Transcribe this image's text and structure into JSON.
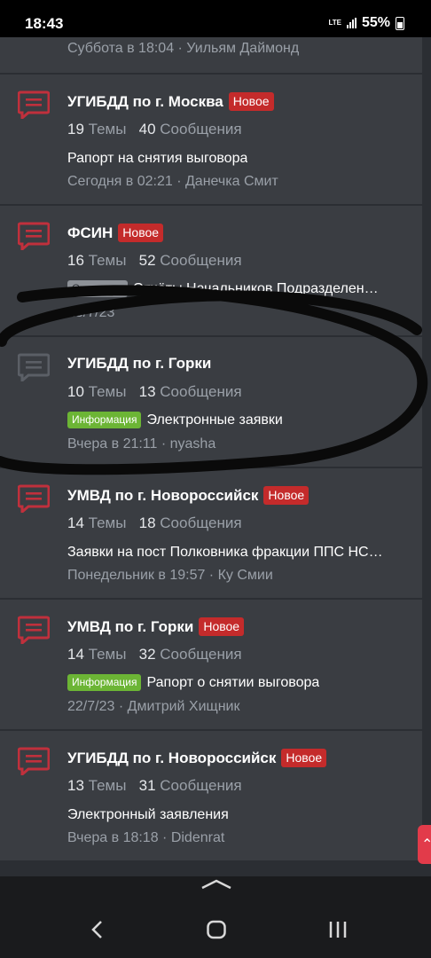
{
  "status": {
    "time": "18:43",
    "network": "LTE",
    "battery": "55%"
  },
  "partial": {
    "meta": "Суббота в 18:04 · Уильям Даймонд"
  },
  "forums": [
    {
      "title": "УГИБДД по г. Москва",
      "new": "Новое",
      "themes": "19",
      "themes_label": "Темы",
      "messages": "40",
      "messages_label": "Сообщения",
      "last_title": "Рапорт на снятия выговора",
      "meta": "Сегодня в 02:21 · Данечка Смит"
    },
    {
      "title": "ФСИН",
      "new": "Новое",
      "themes": "16",
      "themes_label": "Темы",
      "messages": "52",
      "messages_label": "Сообщения",
      "prefix": "Ожидание",
      "last_title": "Отчёты Начальников Подразделен…",
      "meta": "23/7/23"
    },
    {
      "title": "УГИБДД по г. Горки",
      "themes": "10",
      "themes_label": "Темы",
      "messages": "13",
      "messages_label": "Сообщения",
      "prefix": "Информация",
      "last_title": "Электронные заявки",
      "meta": "Вчера в 21:11 · nyasha"
    },
    {
      "title": "УМВД по г. Новороссийск",
      "new": "Новое",
      "themes": "14",
      "themes_label": "Темы",
      "messages": "18",
      "messages_label": "Сообщения",
      "last_title": "Заявки на пост Полковника фракции ППС НС…",
      "meta": "Понедельник в 19:57 · Ку Смии"
    },
    {
      "title": "УМВД по г. Горки",
      "new": "Новое",
      "themes": "14",
      "themes_label": "Темы",
      "messages": "32",
      "messages_label": "Сообщения",
      "prefix": "Информация",
      "last_title": "Рапорт о снятии выговора",
      "meta": "22/7/23 · Дмитрий Хищник"
    },
    {
      "title": "УГИБДД по г. Новороссийск",
      "new": "Новое",
      "themes": "13",
      "themes_label": "Темы",
      "messages": "31",
      "messages_label": "Сообщения",
      "last_title": "Электронный заявления",
      "meta": "Вчера в 18:18 · Didenrat"
    }
  ],
  "colors": {
    "accent_red": "#c42b2b",
    "info_green": "#6cb535",
    "icon_unread": "#c0303c",
    "icon_read": "#5b5f66"
  }
}
